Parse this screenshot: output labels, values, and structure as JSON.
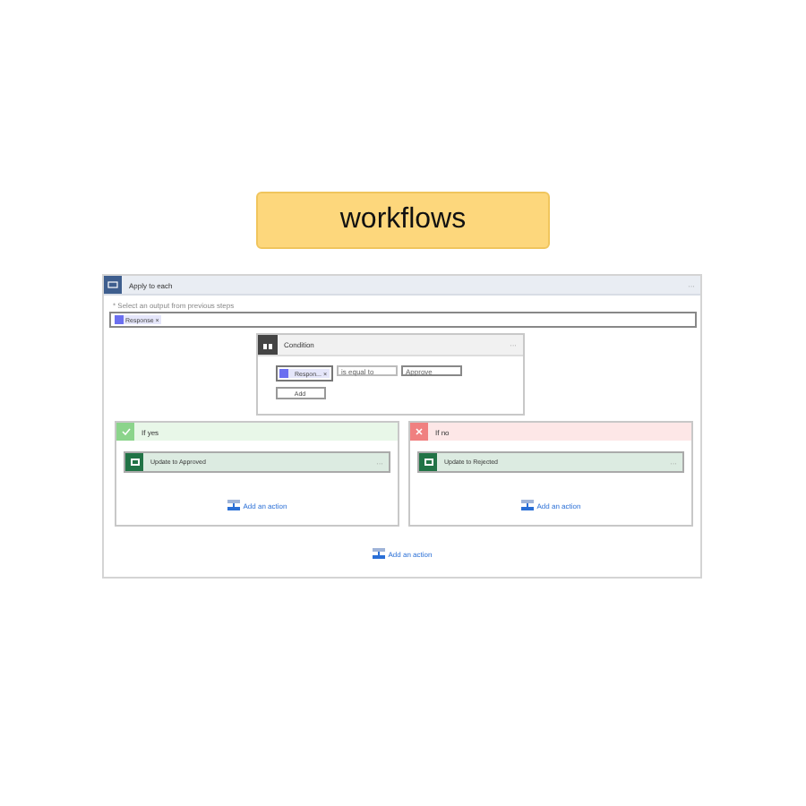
{
  "badge": "workflows",
  "loop": {
    "title": "Apply to each",
    "menu": "···",
    "field_label": "* Select an output from previous steps",
    "token": "Response",
    "token_remove": "×"
  },
  "condition": {
    "title": "Condition",
    "menu": "···",
    "operand": "Respon...",
    "operand_remove": "×",
    "operator": "is equal to",
    "value": "Approve",
    "add": "Add"
  },
  "branches": [
    {
      "kind": "yes",
      "title": "If yes",
      "action": "Update to Approved",
      "action_menu": "···",
      "add_action": "Add an action"
    },
    {
      "kind": "no",
      "title": "If no",
      "action": "Update to Rejected",
      "action_menu": "···",
      "add_action": "Add an action"
    }
  ],
  "add_action": "Add an action"
}
